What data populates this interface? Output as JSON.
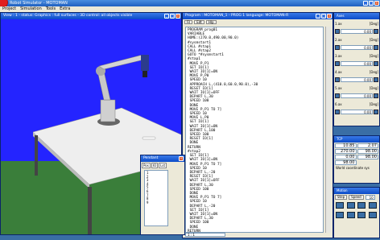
{
  "app": {
    "title": "Robot Simulator - MOTOMAN",
    "menu": [
      "Project",
      "Simulation",
      "Tools",
      "Extra"
    ]
  },
  "view": {
    "title": "View : 1 - status: Graphics : full surfaces - 3D control: all objects visible"
  },
  "program": {
    "title": "Program : MOTOMAN_1 - PROG 1 language: MOTOMAN-R",
    "toolbar": [
      "Fil",
      "Edt",
      "Hlp"
    ],
    "lines": [
      "PROGRAM prog01",
      "VARIABLE",
      "HOME:(270.0,490.00,90.0)",
      "#sysmstart1",
      "CALL #stap1",
      "CALL #stap2",
      "GOTO *#sysmstart1",
      "",
      "#stap1",
      " MOVE P,P1",
      " SET IO[1]",
      " WAIT IO[1]=ON",
      " MOVE P,P0",
      " SPEED 10",
      " APPROACH L,(410.0,60.0,90.0),-30",
      " RESET IO[1]",
      " WAIT IO[1]=OFF",
      " DEPART L,30",
      " SPEED 100",
      " DONE",
      " MOVE P,P1 TO 7]",
      " SPEED 10",
      " MOVE L,P0",
      " SET IO[1]",
      " WAIT IO[1]=ON",
      " DEPART L,100",
      " SPEED 100",
      " RESET IO[1]",
      " DONE",
      "RETURN",
      "",
      "#stap2",
      " SET IO[1]",
      " WAIT IO[1]=ON",
      " MOVE P,P1 TO 7]",
      " SPEED 10",
      " DEPART L,-20",
      " RESET IO[1]",
      " WAIT IO[1]=OFF",
      " DEPART L,30",
      " SPEED 100",
      " DONE",
      " MOVE P,P1 TO 7]",
      " SPEED 10",
      " DEPART L,-20",
      " SET IO[1]",
      " WAIT IO[1]=ON",
      " DEPART L,30",
      " SPEED 100",
      " DONE",
      "RETURN"
    ],
    "status": "1 : 1"
  },
  "pendant": {
    "title": "Pendant",
    "tabs": [
      "Pos",
      "IO",
      "Lst"
    ],
    "list": [
      "1",
      "2",
      "3",
      "4",
      "5",
      "6",
      "7",
      "8",
      "9"
    ]
  },
  "joints": {
    "title": "Axes",
    "rows": [
      {
        "label": "1.ax",
        "unit": "[Deg]",
        "value": "0.00"
      },
      {
        "label": "2.ax",
        "unit": "[Deg]",
        "value": "0.00"
      },
      {
        "label": "3.ax",
        "unit": "[Deg]",
        "value": "0.00"
      },
      {
        "label": "4.ax",
        "unit": "[Deg]",
        "value": "0.00"
      },
      {
        "label": "5.ax",
        "unit": "[Deg]",
        "value": "0.00"
      },
      {
        "label": "6.ax",
        "unit": "[Deg]",
        "value": "0.00"
      }
    ]
  },
  "tcp": {
    "title": "TCP",
    "values": [
      "10.85",
      "2.07",
      "270.00",
      "98.00",
      "0.00",
      "98.00",
      "98.00"
    ],
    "coord_label": "World coordinate sys"
  },
  "motion": {
    "title": "Motion",
    "buttons": [
      "Step",
      "Speed"
    ],
    "speed_value": "10"
  },
  "colors": {
    "desktop": "#3a6ea5",
    "titlebar": "#0b4bc8",
    "window_bg": "#ece9d8",
    "view_bg": "#2424ff",
    "floor": "#3a7e3a"
  }
}
